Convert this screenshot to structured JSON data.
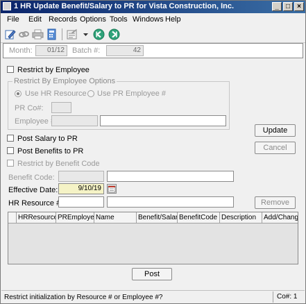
{
  "window": {
    "title": "1 HR Update Benefit/Salary to PR for Vista Construction, Inc.",
    "controls": {
      "minimize": "_",
      "maximize": "□",
      "close": "×"
    }
  },
  "menu": [
    "File",
    "Edit",
    "Records",
    "Options",
    "Tools",
    "Windows",
    "Help"
  ],
  "toolbar": {
    "icons": [
      "edit-icon",
      "link-icon",
      "printer-icon",
      "calculator-icon",
      "notes-icon",
      "dropdown-arrow-icon",
      "back-arrow-icon",
      "forward-arrow-icon"
    ]
  },
  "header": {
    "month_label": "Month:",
    "month_value": "01/12",
    "batch_label": "Batch #:",
    "batch_value": "42"
  },
  "restrict": {
    "by_employee_label": "Restrict by Employee",
    "group_label": "Restrict By Employee Options",
    "use_hr_resource_label": "Use HR Resource #",
    "use_pr_employee_label": "Use PR Employee #",
    "pr_co_label": "PR Co#:",
    "pr_co_value": "",
    "employee_label": "Employee #:",
    "employee_value": "",
    "employee_desc": ""
  },
  "options": {
    "post_salary_label": "Post Salary to PR",
    "post_benefits_label": "Post Benefits to PR",
    "restrict_benefit_label": "Restrict by Benefit Code"
  },
  "fields": {
    "benefit_code_label": "Benefit Code:",
    "benefit_code_value": "",
    "benefit_code_desc": "",
    "effective_date_label": "Effective Date:",
    "effective_date_value": "9/10/19",
    "hr_resource_label": "HR Resource #:",
    "hr_resource_value": "",
    "hr_resource_desc": ""
  },
  "buttons": {
    "update": "Update",
    "cancel": "Cancel",
    "remove": "Remove",
    "post": "Post"
  },
  "grid": {
    "columns": [
      "HRResource",
      "PREmployee",
      "Name",
      "Benefit/Salary",
      "BenefitCode",
      "Description",
      "Add/Change"
    ]
  },
  "status": {
    "message": "Restrict initialization by Resource # or Employee #?",
    "company": "Co#: 1"
  }
}
